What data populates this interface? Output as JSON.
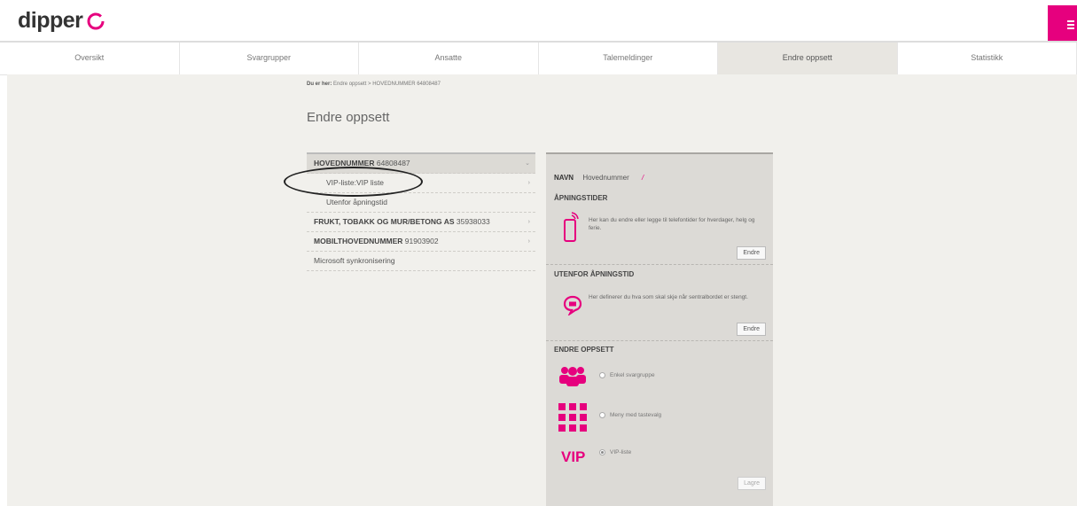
{
  "brand": {
    "logo_text": "dipper",
    "accent": "#e6007e"
  },
  "nav": {
    "tabs": [
      "Oversikt",
      "Svargrupper",
      "Ansatte",
      "Talemeldinger",
      "Endre oppsett",
      "Statistikk"
    ],
    "active_index": 4
  },
  "breadcrumb": {
    "prefix": "Du er her:",
    "path": "Endre oppsett > HOVEDNUMMER 64808487"
  },
  "page_title": "Endre oppsett",
  "tree": [
    {
      "label_bold": "HOVEDNUMMER",
      "label_rest": " 64808487",
      "arrow": "⌄",
      "head": true
    },
    {
      "label_bold": "",
      "label_rest": "VIP-liste:VIP liste",
      "arrow": "›",
      "sub": true
    },
    {
      "label_bold": "",
      "label_rest": "Utenfor åpningstid",
      "arrow": "",
      "sub": true
    },
    {
      "label_bold": "FRUKT, TOBAKK OG MUR/BETONG AS",
      "label_rest": " 35938033",
      "arrow": "›"
    },
    {
      "label_bold": "MOBILTHOVEDNUMMER",
      "label_rest": " 91903902",
      "arrow": "›"
    },
    {
      "label_bold": "",
      "label_rest": "Microsoft synkronisering",
      "arrow": ""
    }
  ],
  "panel": {
    "navn_label": "NAVN",
    "navn_value": "Hovednummer",
    "opening_title": "ÅPNINGSTIDER",
    "opening_text": "Her kan du endre eller legge til telefontider for hverdager, helg og ferie.",
    "opening_button": "Endre",
    "closed_title": "UTENFOR ÅPNINGSTID",
    "closed_text": "Her definerer du hva som skal skje når sentralbordet er stengt.",
    "closed_button": "Endre",
    "setup_title": "ENDRE OPPSETT",
    "options": [
      {
        "label": "Enkel svargruppe",
        "checked": false,
        "icon": "group-icon"
      },
      {
        "label": "Meny med tastevalg",
        "checked": false,
        "icon": "keypad-icon"
      },
      {
        "label": "VIP-liste",
        "checked": true,
        "icon": "vip-icon"
      }
    ],
    "vip_icon_text": "VIP",
    "save_button": "Lagre"
  }
}
